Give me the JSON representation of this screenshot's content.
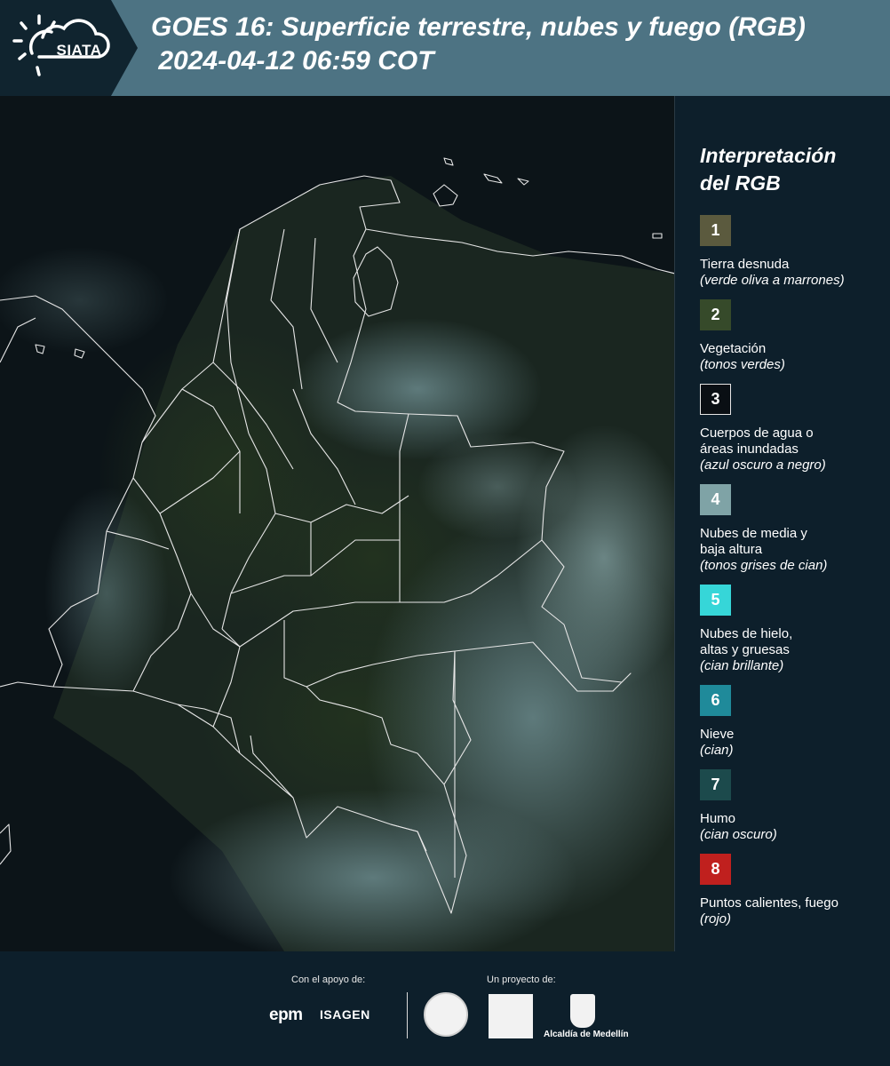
{
  "header": {
    "logo_text": "SIATA",
    "title_line1": "GOES 16: Superficie terrestre, nubes y fuego (RGB)",
    "title_line2": " 2024-04-12 06:59 COT"
  },
  "legend": {
    "title": "Interpretación\ndel RGB",
    "items": [
      {
        "num": "1",
        "color": "#5b5a3e",
        "name": "Tierra desnuda",
        "desc": "(verde oliva a marrones)"
      },
      {
        "num": "2",
        "color": "#364a2a",
        "name": "Vegetación",
        "desc": "(tonos verdes)"
      },
      {
        "num": "3",
        "color": "#0a0f14",
        "name": "Cuerpos de agua o\náreas inundadas",
        "desc": "(azul oscuro a negro)"
      },
      {
        "num": "4",
        "color": "#7fa3a6",
        "name": "Nubes de media y\nbaja altura",
        "desc": "(tonos grises de cian)"
      },
      {
        "num": "5",
        "color": "#36d6d8",
        "name": "Nubes de hielo,\naltas y gruesas",
        "desc": "(cian brillante)"
      },
      {
        "num": "6",
        "color": "#1f8a9a",
        "name": "Nieve",
        "desc": "(cian)"
      },
      {
        "num": "7",
        "color": "#1c4a4c",
        "name": "Humo",
        "desc": "(cian oscuro)"
      },
      {
        "num": "8",
        "color": "#c0201e",
        "name": "Puntos calientes, fuego",
        "desc": "(rojo)"
      }
    ]
  },
  "footer": {
    "support_label": "Con el apoyo de:",
    "project_label": "Un proyecto de:",
    "epm": "epm",
    "isagen": "ISAGEN",
    "alcaldia": "Alcaldía de Medellín"
  }
}
